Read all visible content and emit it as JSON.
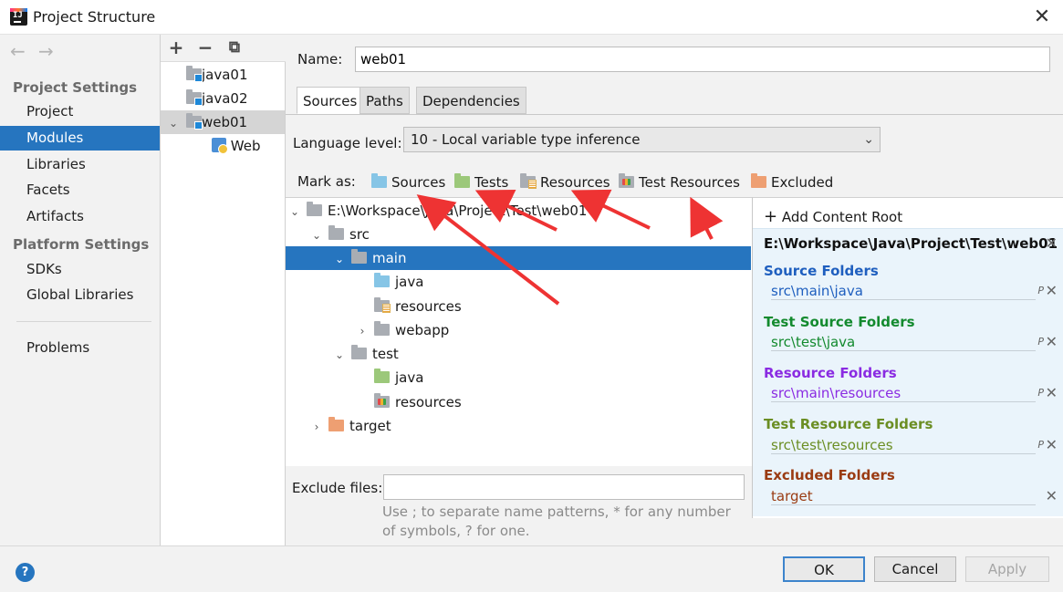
{
  "window": {
    "title": "Project Structure",
    "close_glyph": "✕",
    "logo_text": "IJ"
  },
  "nav": {
    "back": "←",
    "forward": "→",
    "project_settings_header": "Project Settings",
    "project_settings": [
      "Project",
      "Modules",
      "Libraries",
      "Facets",
      "Artifacts"
    ],
    "platform_settings_header": "Platform Settings",
    "platform_settings": [
      "SDKs",
      "Global Libraries"
    ],
    "problems": "Problems",
    "selected": "Modules"
  },
  "modules": {
    "toolbar": {
      "add": "+",
      "remove": "−",
      "copy": "⧉"
    },
    "items": [
      {
        "label": "java01"
      },
      {
        "label": "java02"
      },
      {
        "label": "web01",
        "selected": true,
        "expanded": true
      },
      {
        "label": "Web",
        "facet": true
      }
    ],
    "expand_glyph": "⌄"
  },
  "main": {
    "name_label": "Name:",
    "name_value": "web01",
    "tabs": [
      "Sources",
      "Paths",
      "Dependencies"
    ],
    "active_tab": "Sources",
    "language_label": "Language level:",
    "language_value": "10 - Local variable type inference",
    "language_chevron": "⌄",
    "mark_as_label": "Mark as:",
    "mark_as": [
      {
        "label": "Sources",
        "icon": "sources-folder-icon"
      },
      {
        "label": "Tests",
        "icon": "tests-folder-icon"
      },
      {
        "label": "Resources",
        "icon": "resources-folder-icon"
      },
      {
        "label": "Test Resources",
        "icon": "test-resources-folder-icon"
      },
      {
        "label": "Excluded",
        "icon": "excluded-folder-icon"
      }
    ]
  },
  "tree": {
    "rows": [
      {
        "label": "E:\\Workspace\\Java\\Project\\Test\\web01",
        "chev": "⌄",
        "icon": "gray"
      },
      {
        "label": "src",
        "chev": "⌄",
        "icon": "gray"
      },
      {
        "label": "main",
        "chev": "⌄",
        "icon": "gray",
        "selected": true
      },
      {
        "label": "java",
        "chev": "",
        "icon": "blue"
      },
      {
        "label": "resources",
        "chev": "",
        "icon": "res"
      },
      {
        "label": "webapp",
        "chev": "›",
        "icon": "gray"
      },
      {
        "label": "test",
        "chev": "⌄",
        "icon": "gray"
      },
      {
        "label": "java",
        "chev": "",
        "icon": "green"
      },
      {
        "label": "resources",
        "chev": "",
        "icon": "tres"
      },
      {
        "label": "target",
        "chev": "›",
        "icon": "orange"
      }
    ]
  },
  "exclude": {
    "label": "Exclude files:",
    "value": "",
    "hint": "Use ; to separate name patterns, * for any number of symbols, ? for one."
  },
  "content_roots": {
    "add_label": "Add Content Root",
    "add_glyph": "+",
    "root_path": "E:\\Workspace\\Java\\Project\\Test\\web01",
    "remove_glyph": "✕",
    "properties_glyph": "P",
    "sections": [
      {
        "title": "Source Folders",
        "path": "src\\main\\java",
        "color": "#1f5fbf",
        "has_props": true
      },
      {
        "title": "Test Source Folders",
        "path": "src\\test\\java",
        "color": "#138a2e",
        "has_props": true
      },
      {
        "title": "Resource Folders",
        "path": "src\\main\\resources",
        "color": "#8a2be2",
        "has_props": true
      },
      {
        "title": "Test Resource Folders",
        "path": "src\\test\\resources",
        "color": "#6b8e23",
        "has_props": true
      },
      {
        "title": "Excluded Folders",
        "path": "target",
        "color": "#9a3b12",
        "has_props": false
      }
    ]
  },
  "footer": {
    "help": "?",
    "ok": "OK",
    "cancel": "Cancel",
    "apply": "Apply"
  },
  "colors": {
    "selection": "#2675bf",
    "annotation_arrow": "#ee3333"
  }
}
